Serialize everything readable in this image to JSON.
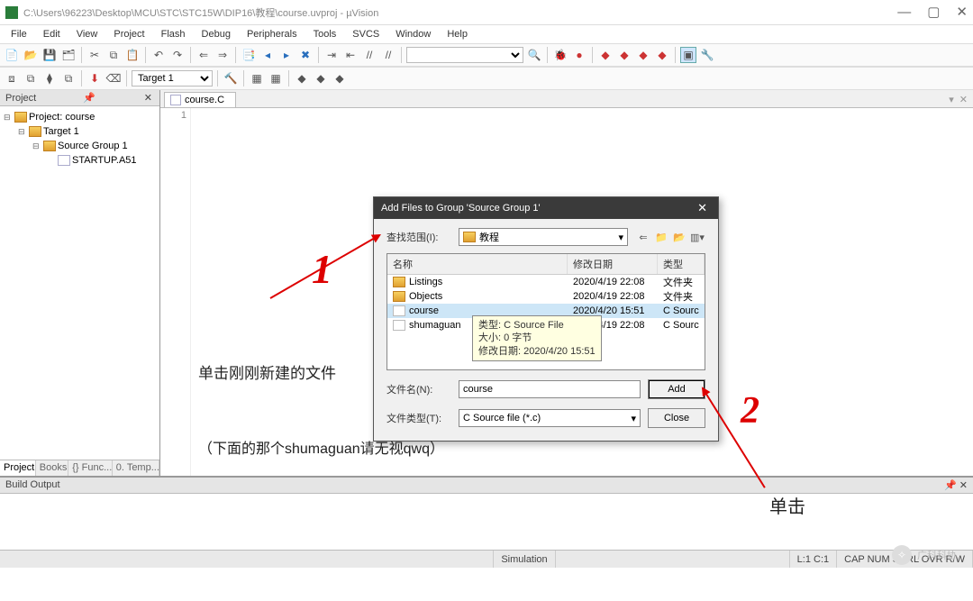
{
  "window": {
    "title": "C:\\Users\\96223\\Desktop\\MCU\\STC\\STC15W\\DIP16\\教程\\course.uvproj - µVision"
  },
  "menus": [
    "File",
    "Edit",
    "View",
    "Project",
    "Flash",
    "Debug",
    "Peripherals",
    "Tools",
    "SVCS",
    "Window",
    "Help"
  ],
  "toolbar2": {
    "target_select": "Target 1"
  },
  "project_panel": {
    "title": "Project",
    "root": "Project: course",
    "target": "Target 1",
    "group": "Source Group 1",
    "file": "STARTUP.A51",
    "tabs": [
      "Project",
      "Books",
      "{} Func...",
      "0. Temp..."
    ]
  },
  "editor": {
    "tab": "course.C",
    "line1": "1"
  },
  "dialog": {
    "title": "Add Files to Group 'Source Group 1'",
    "lookin_label": "查找范围(I):",
    "lookin_value": "教程",
    "columns": {
      "name": "名称",
      "date": "修改日期",
      "type": "类型"
    },
    "rows": [
      {
        "name": "Listings",
        "date": "2020/4/19 22:08",
        "type": "文件夹",
        "icon": "folder",
        "sel": false
      },
      {
        "name": "Objects",
        "date": "2020/4/19 22:08",
        "type": "文件夹",
        "icon": "folder",
        "sel": false
      },
      {
        "name": "course",
        "date": "2020/4/20 15:51",
        "type": "C Sourc",
        "icon": "cfile",
        "sel": true
      },
      {
        "name": "shumaguan",
        "date": "2020/4/19 22:08",
        "type": "C Sourc",
        "icon": "cfile",
        "sel": false
      }
    ],
    "tooltip": {
      "l1": "类型: C Source File",
      "l2": "大小: 0 字节",
      "l3": "修改日期: 2020/4/20 15:51"
    },
    "filename_label": "文件名(N):",
    "filename_value": "course",
    "filetype_label": "文件类型(T):",
    "filetype_value": "C Source file (*.c)",
    "btn_add": "Add",
    "btn_close": "Close"
  },
  "build_output": {
    "title": "Build Output"
  },
  "status": {
    "mid": "Simulation",
    "pos": "L:1 C:1",
    "caps": "CAP NUM SCRL OVR R/W"
  },
  "annotations": {
    "text1": "单击刚刚新建的文件",
    "num1": "1",
    "num2": "2",
    "text2": "单击",
    "text3": "（下面的那个shumaguan请无视qwq）"
  },
  "watermark": "广科科协"
}
